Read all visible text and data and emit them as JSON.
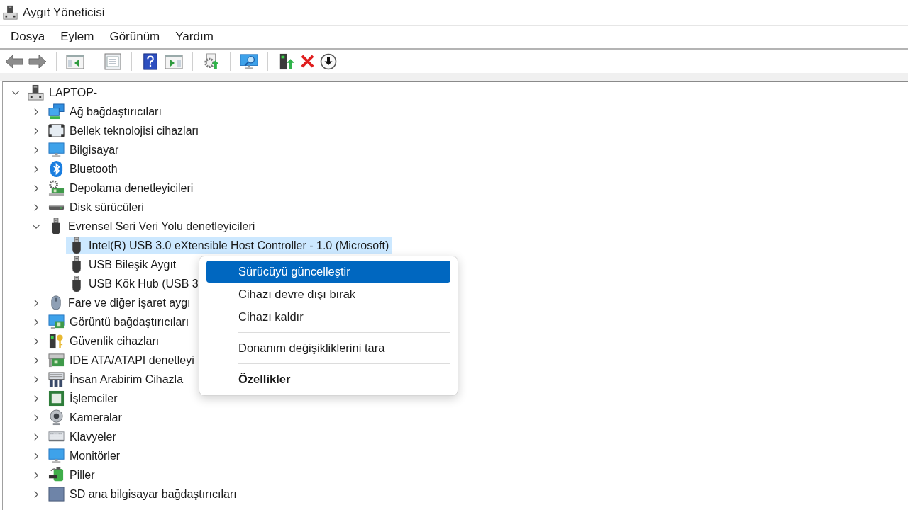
{
  "window": {
    "title": "Aygıt Yöneticisi"
  },
  "menu_bar": [
    "Dosya",
    "Eylem",
    "Görünüm",
    "Yardım"
  ],
  "tree": {
    "label": "LAPTOP-",
    "selected": false,
    "expanded": true,
    "children": [
      {
        "label": "Ağ bağdaştırıcıları",
        "selected": false,
        "expanded": false
      },
      {
        "label": "Bellek teknolojisi cihazları",
        "selected": false,
        "expanded": false
      },
      {
        "label": "Bilgisayar",
        "selected": false,
        "expanded": false
      },
      {
        "label": "Bluetooth",
        "selected": false,
        "expanded": false
      },
      {
        "label": "Depolama denetleyicileri",
        "selected": false,
        "expanded": false
      },
      {
        "label": "Disk sürücüleri",
        "selected": false,
        "expanded": false
      },
      {
        "label": "Evrensel Seri Veri Yolu denetleyicileri",
        "selected": false,
        "expanded": true,
        "children": [
          {
            "label": "Intel(R) USB 3.0 eXtensible Host Controller - 1.0 (Microsoft)",
            "selected": true
          },
          {
            "label": "USB Bileşik Aygıt",
            "selected": false
          },
          {
            "label": "USB Kök Hub (USB 3",
            "selected": false
          }
        ]
      },
      {
        "label": "Fare ve diğer işaret aygı",
        "selected": false,
        "expanded": false
      },
      {
        "label": "Görüntü bağdaştırıcıları",
        "selected": false,
        "expanded": false
      },
      {
        "label": "Güvenlik cihazları",
        "selected": false,
        "expanded": false
      },
      {
        "label": "IDE ATA/ATAPI denetleyi",
        "selected": false,
        "expanded": false
      },
      {
        "label": "İnsan Arabirim Cihazla",
        "selected": false,
        "expanded": false
      },
      {
        "label": "İşlemciler",
        "selected": false,
        "expanded": false
      },
      {
        "label": "Kameralar",
        "selected": false,
        "expanded": false
      },
      {
        "label": "Klavyeler",
        "selected": false,
        "expanded": false
      },
      {
        "label": "Monitörler",
        "selected": false,
        "expanded": false
      },
      {
        "label": "Piller",
        "selected": false,
        "expanded": false
      },
      {
        "label": "SD ana bilgisayar bağdaştırıcıları",
        "selected": false,
        "expanded": false
      }
    ]
  },
  "context_menu": {
    "items": [
      {
        "kind": "item",
        "label": "Sürücüyü güncelleştir",
        "highlighted": true,
        "default": false
      },
      {
        "kind": "item",
        "label": "Cihazı devre dışı bırak",
        "highlighted": false,
        "default": false
      },
      {
        "kind": "item",
        "label": "Cihazı kaldır",
        "highlighted": false,
        "default": false
      },
      {
        "kind": "separator"
      },
      {
        "kind": "item",
        "label": "Donanım değişikliklerini tara",
        "highlighted": false,
        "default": false
      },
      {
        "kind": "separator"
      },
      {
        "kind": "item",
        "label": "Özellikler",
        "highlighted": false,
        "default": true
      }
    ]
  }
}
